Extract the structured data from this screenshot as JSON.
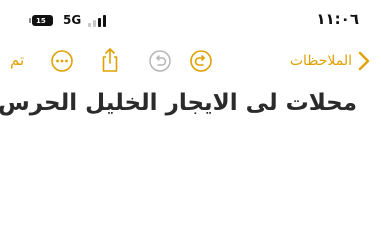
{
  "status_bar": {
    "time": "١١:٠٦",
    "network": "5G",
    "battery_level": "15",
    "icons": [
      "battery-icon",
      "signal-bars-icon"
    ]
  },
  "toolbar": {
    "done_label": "تم",
    "back_label": "الملاحظات",
    "accent_color": "#e0a100",
    "icons": [
      "more-icon",
      "share-icon",
      "undo-icon",
      "redo-icon",
      "chevron-back-icon"
    ]
  },
  "note": {
    "title": "محلات لى الايجار الخليل الحرس"
  }
}
